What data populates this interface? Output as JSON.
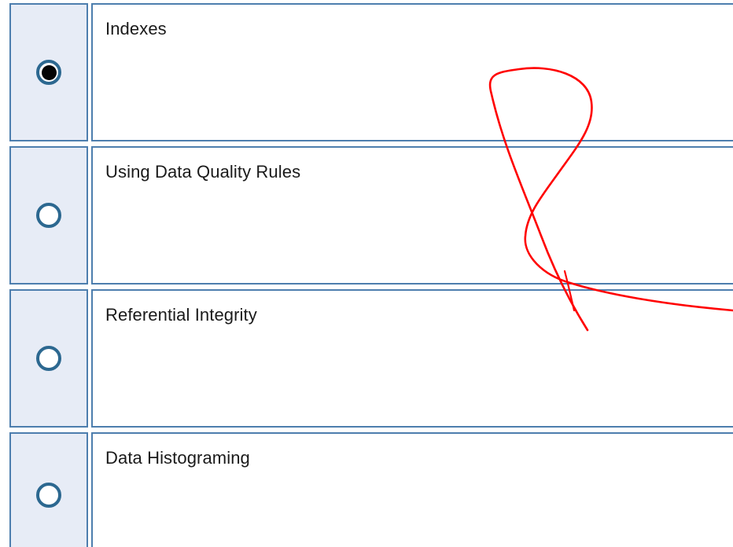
{
  "question": {
    "options": [
      {
        "label": "Indexes",
        "selected": true
      },
      {
        "label": "Using Data Quality Rules",
        "selected": false
      },
      {
        "label": "Referential Integrity",
        "selected": false
      },
      {
        "label": "Data Histograming",
        "selected": false
      }
    ]
  },
  "colors": {
    "radio_cell_bg": "#e7ecf6",
    "border": "#4d7eae",
    "radio_ring": "#2c6890",
    "radio_dot": "#050505",
    "annotation_stroke": "#ff0000"
  },
  "icons": {
    "selected_radio": "radio-selected-icon",
    "unselected_radio": "radio-unselected-icon",
    "annotation": "handwritten-scribble-icon"
  }
}
